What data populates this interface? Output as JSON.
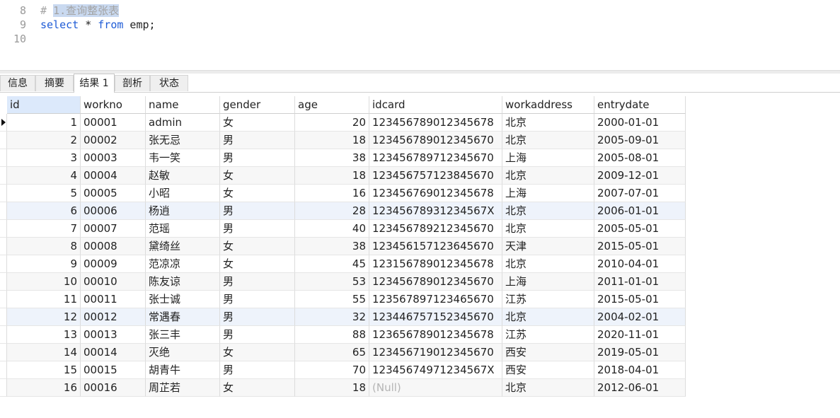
{
  "editor": {
    "lines": [
      {
        "num": "8",
        "text": "# 1.查询整张表",
        "style": "comment-selected"
      },
      {
        "num": "9",
        "parts": [
          [
            "kw",
            "select"
          ],
          [
            "plain",
            " * "
          ],
          [
            "kw",
            "from"
          ],
          [
            "plain",
            " emp;"
          ]
        ]
      },
      {
        "num": "10",
        "text": ""
      }
    ]
  },
  "tabs": [
    {
      "label": "信息",
      "active": false
    },
    {
      "label": "摘要",
      "active": false
    },
    {
      "label": "结果 1",
      "active": true
    },
    {
      "label": "剖析",
      "active": false
    },
    {
      "label": "状态",
      "active": false
    }
  ],
  "table": {
    "columns": [
      "id",
      "workno",
      "name",
      "gender",
      "age",
      "idcard",
      "workaddress",
      "entrydate"
    ],
    "current_row_index": 0,
    "rows": [
      [
        "1",
        "00001",
        "admin",
        "女",
        "20",
        "123456789012345678",
        "北京",
        "2000-01-01"
      ],
      [
        "2",
        "00002",
        "张无忌",
        "男",
        "18",
        "123456789012345670",
        "北京",
        "2005-09-01"
      ],
      [
        "3",
        "00003",
        "韦一笑",
        "男",
        "38",
        "123456789712345670",
        "上海",
        "2005-08-01"
      ],
      [
        "4",
        "00004",
        "赵敏",
        "女",
        "18",
        "123456757123845670",
        "北京",
        "2009-12-01"
      ],
      [
        "5",
        "00005",
        "小昭",
        "女",
        "16",
        "123456769012345678",
        "上海",
        "2007-07-01"
      ],
      [
        "6",
        "00006",
        "杨逍",
        "男",
        "28",
        "12345678931234567X",
        "北京",
        "2006-01-01"
      ],
      [
        "7",
        "00007",
        "范瑶",
        "男",
        "40",
        "123456789212345670",
        "北京",
        "2005-05-01"
      ],
      [
        "8",
        "00008",
        "黛绮丝",
        "女",
        "38",
        "123456157123645670",
        "天津",
        "2015-05-01"
      ],
      [
        "9",
        "00009",
        "范凉凉",
        "女",
        "45",
        "123156789012345678",
        "北京",
        "2010-04-01"
      ],
      [
        "10",
        "00010",
        "陈友谅",
        "男",
        "53",
        "123456789012345670",
        "上海",
        "2011-01-01"
      ],
      [
        "11",
        "00011",
        "张士诚",
        "男",
        "55",
        "123567897123465670",
        "江苏",
        "2015-05-01"
      ],
      [
        "12",
        "00012",
        "常遇春",
        "男",
        "32",
        "123446757152345670",
        "北京",
        "2004-02-01"
      ],
      [
        "13",
        "00013",
        "张三丰",
        "男",
        "88",
        "123656789012345678",
        "江苏",
        "2020-11-01"
      ],
      [
        "14",
        "00014",
        "灭绝",
        "女",
        "65",
        "123456719012345670",
        "西安",
        "2019-05-01"
      ],
      [
        "15",
        "00015",
        "胡青牛",
        "男",
        "70",
        "12345674971234567X",
        "西安",
        "2018-04-01"
      ],
      [
        "16",
        "00016",
        "周芷若",
        "女",
        "18",
        "(Null)",
        "北京",
        "2012-06-01"
      ]
    ]
  }
}
